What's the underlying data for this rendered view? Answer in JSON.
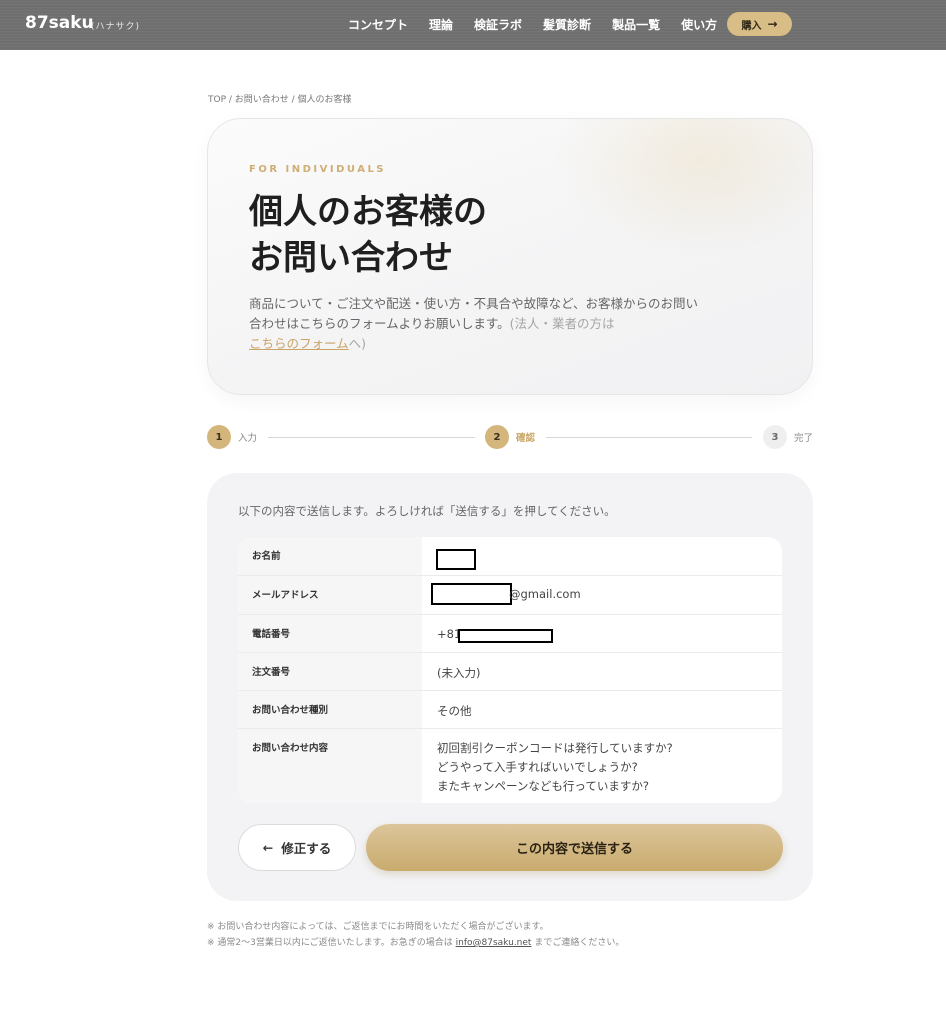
{
  "header": {
    "logo": "87saku",
    "logo_sub": "(ハナサク)",
    "nav": [
      "コンセプト",
      "理論",
      "検証ラボ",
      "髪質診断",
      "製品一覧",
      "使い方"
    ],
    "buy_label": "購入",
    "buy_arrow": "→"
  },
  "breadcrumb": "TOP / お問い合わせ / 個人のお客様",
  "hero": {
    "eyebrow": "FOR INDIVIDUALS",
    "title_line1": "個人のお客様の",
    "title_line2": "お問い合わせ",
    "desc_main": "商品について・ご注文や配送・使い方・不具合や故障など、お客様からのお問い合わせはこちらのフォームよりお願いします。",
    "desc_muted_prefix": "(法人・業者の方は",
    "desc_link": "こちらのフォーム",
    "desc_muted_suffix": "へ)"
  },
  "stepper": {
    "steps": [
      {
        "num": "1",
        "label": "入力",
        "state": "done"
      },
      {
        "num": "2",
        "label": "確認",
        "state": "current"
      },
      {
        "num": "3",
        "label": "完了",
        "state": "todo"
      }
    ]
  },
  "confirm": {
    "intro": "以下の内容で送信します。よろしければ「送信する」を押してください。",
    "rows": [
      {
        "label": "お名前",
        "value": ""
      },
      {
        "label": "メールアドレス",
        "value": "@gmail.com"
      },
      {
        "label": "電話番号",
        "value": "+81"
      },
      {
        "label": "注文番号",
        "value": "(未入力)"
      },
      {
        "label": "お問い合わせ種別",
        "value": "その他"
      },
      {
        "label": "お問い合わせ内容",
        "value_lines": [
          "初回割引クーポンコードは発行していますか?",
          "どうやって入手すればいいでしょうか?",
          "またキャンペーンなども行っていますか?"
        ]
      }
    ],
    "back_arrow": "←",
    "back_label": "修正する",
    "submit_label": "この内容で送信する"
  },
  "notes": {
    "line1": "※ お問い合わせ内容によっては、ご返信までにお時間をいただく場合がございます。",
    "line2_prefix": "※ 通常2〜3営業日以内にご返信いたします。お急ぎの場合は ",
    "email": "info@87saku.net",
    "line2_suffix": " までご連絡ください。"
  },
  "colors": {
    "gold": "#d4b67c",
    "header_bg": "#6f6f6f",
    "panel_bg": "#f3f3f5"
  }
}
